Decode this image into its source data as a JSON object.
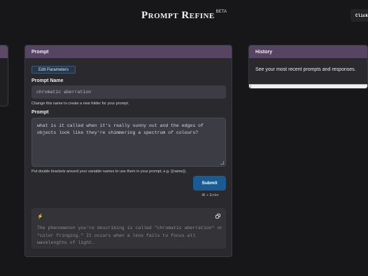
{
  "header": {
    "title": "Prompt Refine",
    "badge": "BETA",
    "click_label": "Click"
  },
  "prompt_panel": {
    "title": "Prompt",
    "edit_parameters_label": "Edit Parameters",
    "prompt_name_label": "Prompt Name",
    "prompt_name_value": "chromatic aberration",
    "prompt_name_hint": "Change this name to create a new folder for your prompt.",
    "prompt_label": "Prompt",
    "prompt_value": "what is it called when it's really sunny out and the edges of objects look like they're shimmering a spectrum of colours?",
    "prompt_hint": "Put double brackets around your variable names to use them in your prompt, e.g. {{name}}.",
    "submit_label": "Submit",
    "shortcut_label": "⌘ + Enter",
    "response_text": "The phenomenon you're describing is called \"chromatic aberration\" or \"color fringing.\" It occurs when a lens fails to focus all wavelengths of light…"
  },
  "history_panel": {
    "title": "History",
    "description": "See your most recent prompts and responses."
  },
  "icons": {
    "response": "lightning-bolt-icon",
    "copy": "copy-icon",
    "shortcut": "command-key-icon"
  },
  "colors": {
    "panel_header": "#554562",
    "submit_button": "#1b5a92",
    "background": "#171719"
  }
}
